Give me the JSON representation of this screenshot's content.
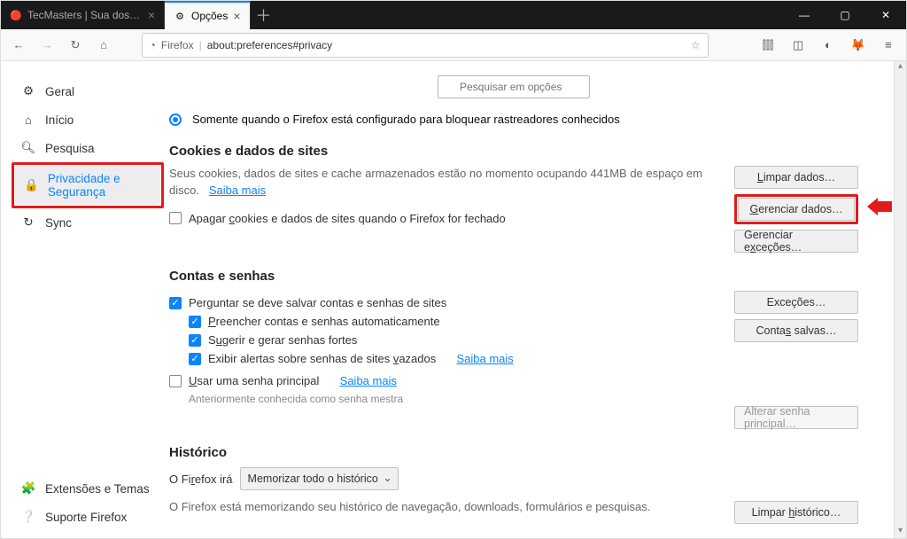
{
  "window": {
    "tabs": [
      {
        "title": "TecMasters | Sua dose diária de",
        "favicon": "🔴"
      },
      {
        "title": "Opções",
        "favicon": "⚙"
      }
    ],
    "controls": {
      "minimize": "—",
      "maximize": "▢",
      "close": "✕"
    },
    "newtab": "＋"
  },
  "toolbar": {
    "url_identity": "Firefox",
    "url_path": "about:preferences#privacy"
  },
  "search": {
    "placeholder": "Pesquisar em opções"
  },
  "sidebar": {
    "items": [
      {
        "label": "Geral"
      },
      {
        "label": "Início"
      },
      {
        "label": "Pesquisa"
      },
      {
        "label": "Privacidade e Segurança"
      },
      {
        "label": "Sync"
      }
    ],
    "footer": [
      {
        "label": "Extensões e Temas"
      },
      {
        "label": "Suporte Firefox"
      }
    ]
  },
  "main": {
    "radio_label": "Somente quando o Firefox está configurado para bloquear rastreadores conhecidos",
    "cookies": {
      "heading": "Cookies e dados de sites",
      "desc_line": "Seus cookies, dados de sites e cache armazenados estão no momento ocupando 441MB de espaço em disco.",
      "learn_more": "Saiba mais",
      "clear_btn": "Limpar dados…",
      "manage_btn": "Gerenciar dados…",
      "exceptions_btn": "Gerenciar exceções…",
      "delete_on_close": "Apagar cookies e dados de sites quando o Firefox for fechado"
    },
    "logins": {
      "heading": "Contas e senhas",
      "ask_save": "Perguntar se deve salvar contas e senhas de sites",
      "autofill": "Preencher contas e senhas automaticamente",
      "suggest": "Sugerir e gerar senhas fortes",
      "alerts": "Exibir alertas sobre senhas de sites vazados",
      "learn_more": "Saiba mais",
      "master_pw": "Usar uma senha principal",
      "master_learn": "Saiba mais",
      "master_note": "Anteriormente conhecida como senha mestra",
      "exc_btn": "Exceções…",
      "saved_btn": "Contas salvas…",
      "change_master": "Alterar senha principal…"
    },
    "history": {
      "heading": "Histórico",
      "prefix": "O Firefox irá",
      "select_value": "Memorizar todo o histórico",
      "desc": "O Firefox está memorizando seu histórico de navegação, downloads, formulários e pesquisas.",
      "clear_btn": "Limpar histórico…"
    }
  }
}
